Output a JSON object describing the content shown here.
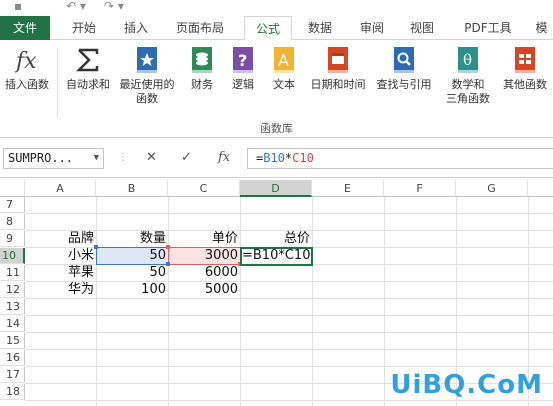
{
  "tabs": [
    "文件",
    "开始",
    "插入",
    "页面布局",
    "公式",
    "数据",
    "审阅",
    "视图",
    "PDF工具",
    "模"
  ],
  "ribbon": {
    "buttons": [
      {
        "label": "插入函数",
        "icon": "fx-icon"
      },
      {
        "label": "自动求和",
        "icon": "sigma-icon",
        "dropdown": true
      },
      {
        "label": "最近使用的\n函数",
        "icon": "star-book-icon",
        "dropdown": true
      },
      {
        "label": "财务",
        "icon": "coins-book-icon",
        "dropdown": true
      },
      {
        "label": "逻辑",
        "icon": "question-book-icon",
        "dropdown": true
      },
      {
        "label": "文本",
        "icon": "letter-a-book-icon",
        "dropdown": true
      },
      {
        "label": "日期和时间",
        "icon": "calendar-book-icon",
        "dropdown": true
      },
      {
        "label": "查找与引用",
        "icon": "magnifier-book-icon",
        "dropdown": true
      },
      {
        "label": "数学和\n三角函数",
        "icon": "theta-book-icon",
        "dropdown": true
      },
      {
        "label": "其他函数",
        "icon": "more-book-icon",
        "dropdown": true
      }
    ],
    "group_label": "函数库"
  },
  "formula_bar": {
    "name_box": "SUMPRO...",
    "cancel": "✕",
    "enter": "✓",
    "fx": "fx",
    "formula_prefix": "=",
    "formula_ref1": "B10",
    "formula_op": "*",
    "formula_ref2": "C10"
  },
  "columns": [
    "A",
    "B",
    "C",
    "D",
    "E",
    "F",
    "G"
  ],
  "rows": [
    "7",
    "8",
    "9",
    "10",
    "11",
    "12",
    "13",
    "14",
    "15",
    "16",
    "17",
    "18"
  ],
  "table": {
    "headers": {
      "A": "品牌",
      "B": "数量",
      "C": "单价",
      "D": "总价"
    },
    "rows": [
      {
        "A": "小米",
        "B": "50",
        "C": "3000",
        "D": "=B10*C10"
      },
      {
        "A": "苹果",
        "B": "50",
        "C": "6000"
      },
      {
        "A": "华为",
        "B": "100",
        "C": "5000"
      }
    ]
  },
  "colors": {
    "accent": "#217346",
    "ref1": "#4472c4",
    "ref2": "#e06060"
  },
  "watermark": "UiBQ.CoM"
}
